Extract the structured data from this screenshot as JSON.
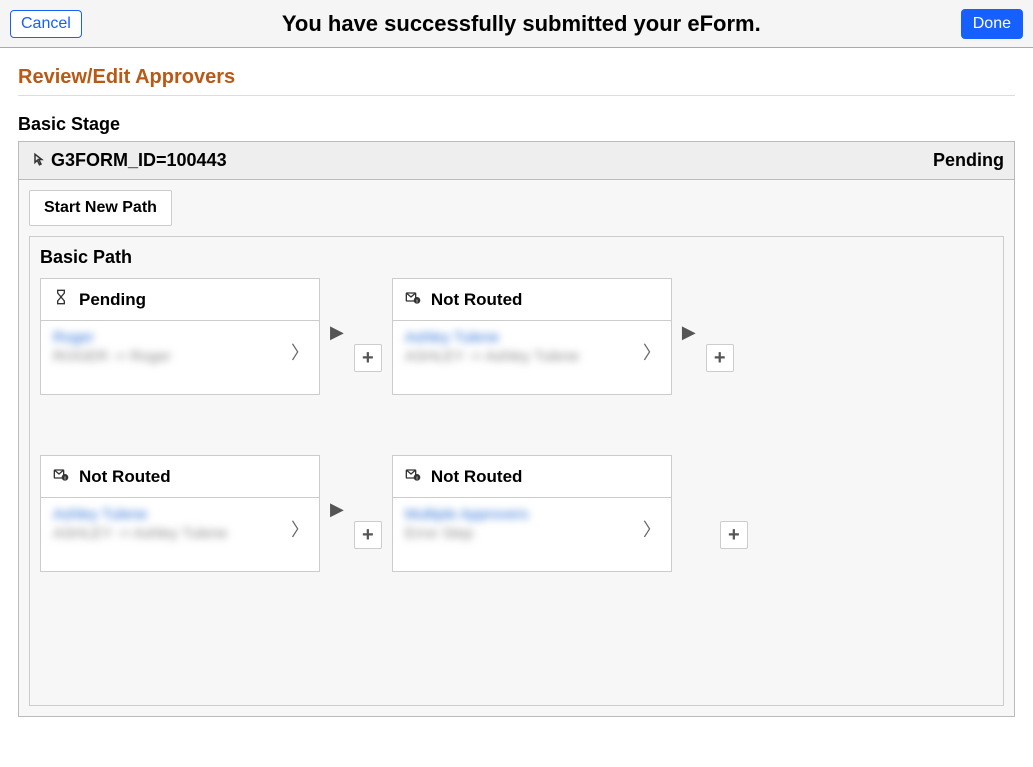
{
  "header": {
    "cancel": "Cancel",
    "title": "You have successfully submitted your eForm.",
    "done": "Done"
  },
  "section": {
    "title": "Review/Edit Approvers",
    "stage_title": "Basic Stage",
    "form_id": "G3FORM_ID=100443",
    "status": "Pending",
    "start_path_btn": "Start New Path",
    "path_title": "Basic Path"
  },
  "cards": {
    "row1": [
      {
        "status": "Pending",
        "icon": "hourglass",
        "link": "Roger",
        "detail": "ROGER -> Roger"
      },
      {
        "status": "Not Routed",
        "icon": "notrouted",
        "link": "Ashley Tulene",
        "detail": "ASHLEY -> Ashley Tulene"
      }
    ],
    "row2": [
      {
        "status": "Not Routed",
        "icon": "notrouted",
        "link": "Ashley Tulene",
        "detail": "ASHLEY -> Ashley Tulene"
      },
      {
        "status": "Not Routed",
        "icon": "notrouted",
        "link": "Multiple Approvers",
        "detail": "Error Step"
      }
    ]
  }
}
